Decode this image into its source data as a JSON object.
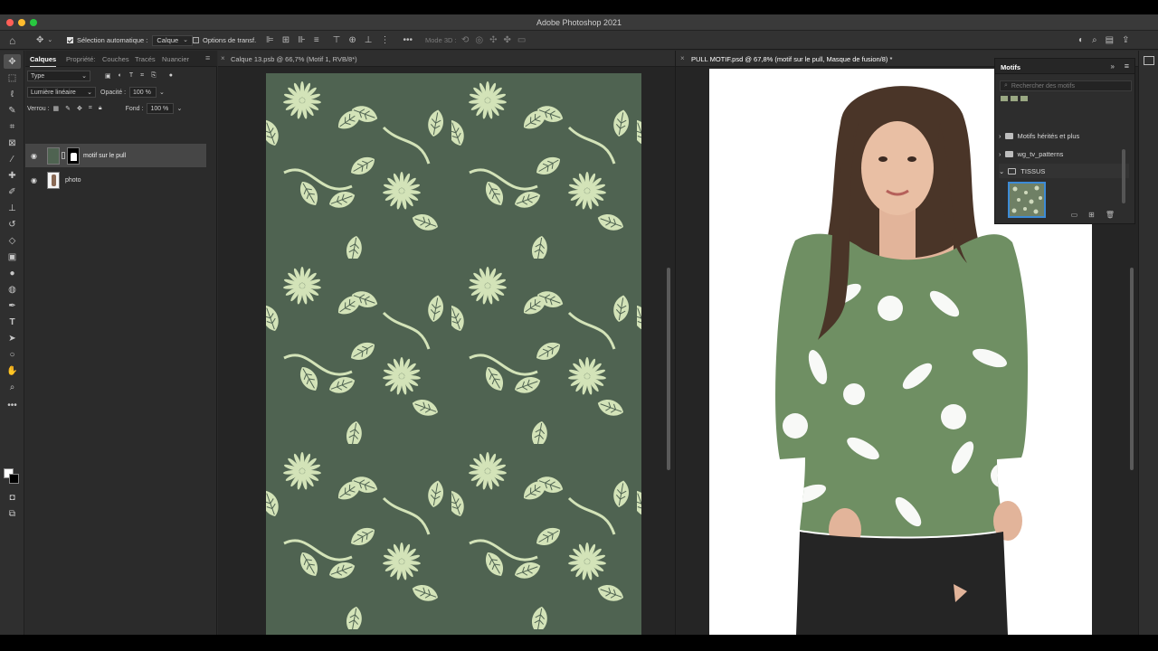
{
  "window": {
    "title": "Adobe Photoshop 2021"
  },
  "options_bar": {
    "auto_select_label": "Sélection automatique :",
    "auto_select_value": "Calque",
    "transform_label": "Options de transf.",
    "mode3d_label": "Mode 3D :"
  },
  "layers_panel": {
    "tabs": [
      "Calques",
      "Propriété:",
      "Couches",
      "Tracés",
      "Nuancier"
    ],
    "filter_value": "Type",
    "blend_mode": "Lumière linéaire",
    "opacity_label": "Opacité :",
    "opacity_value": "100 %",
    "lock_label": "Verrou :",
    "fill_label": "Fond :",
    "fill_value": "100 %",
    "layers": [
      {
        "name": "motif sur le pull",
        "selected": true
      },
      {
        "name": "photo",
        "selected": false
      }
    ]
  },
  "documents": [
    {
      "tab_label": "Calque 13.psb @ 66,7% (Motif 1, RVB/8*)"
    },
    {
      "tab_label": "PULL MOTIF.psd @ 67,8% (motif sur le pull, Masque de fusion/8) *"
    }
  ],
  "motifs_panel": {
    "title": "Motifs",
    "search_placeholder": "Rechercher des motifs",
    "folders": [
      {
        "label": "Motifs hérités et plus",
        "expanded": false
      },
      {
        "label": "wg_tv_patterns",
        "expanded": false
      },
      {
        "label": "TISSUS",
        "expanded": true
      }
    ]
  },
  "colors": {
    "pattern_bg": "#4f6351",
    "pattern_fg": "#d3e3b8",
    "sweater": "#6f8f63",
    "selection_accent": "#3d8bd6"
  }
}
